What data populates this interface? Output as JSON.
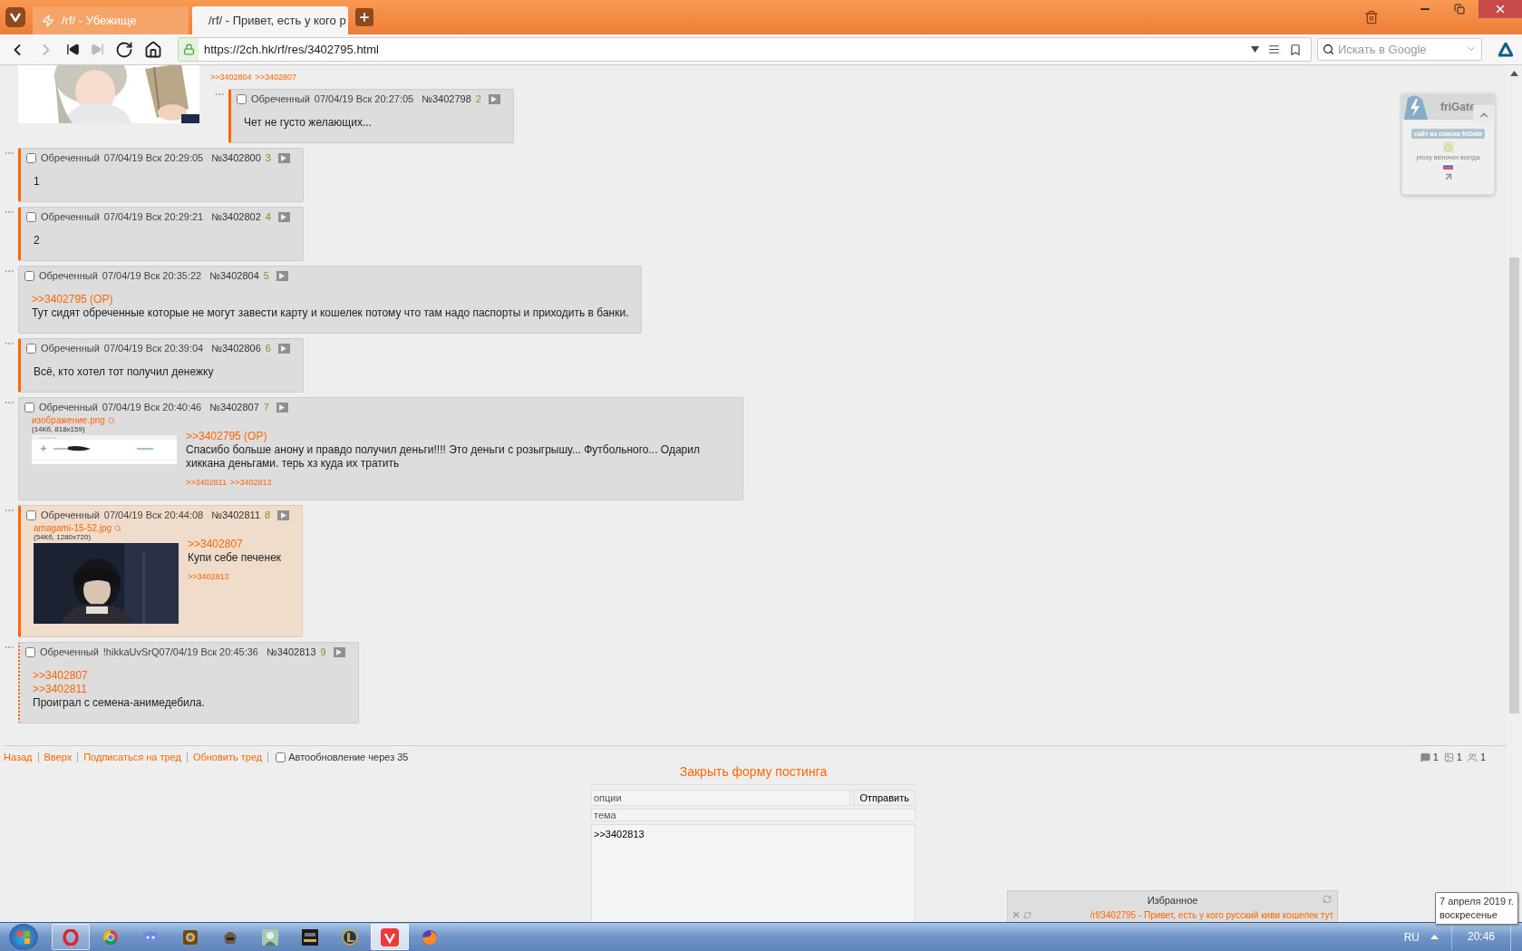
{
  "browser": {
    "tabs": [
      {
        "title": "/rf/ - Убежище",
        "selected": false
      },
      {
        "title": "/rf/ - Привет, есть у кого р",
        "selected": true
      }
    ],
    "nav": [
      {
        "kind": "back",
        "disabled": false
      },
      {
        "kind": "forward",
        "disabled": true
      },
      {
        "kind": "first",
        "disabled": false
      },
      {
        "kind": "last",
        "disabled": true
      },
      {
        "kind": "reload",
        "disabled": false
      },
      {
        "kind": "home",
        "disabled": false
      }
    ],
    "url": "https://2ch.hk/rf/res/3402795.html",
    "search": {
      "placeholder": "Искать в Google"
    }
  },
  "thread": {
    "cut_post": {
      "backlinks": [
        ">>3402804",
        ">>3402807"
      ],
      "replies": [
        {
          "name": "Обреченный",
          "date": "07/04/19 Вск 20:27:05",
          "number": "№3402798",
          "index": "2",
          "checked": false,
          "kind": "solid",
          "highlighted": false,
          "text": "Чет не густо желающих..."
        }
      ]
    },
    "posts": [
      {
        "name": "Обреченный",
        "date": "07/04/19 Вск 20:29:05",
        "number": "№3402800",
        "index": "3",
        "checked": false,
        "kind": "solid",
        "highlighted": false,
        "text": "1"
      },
      {
        "name": "Обреченный",
        "date": "07/04/19 Вск 20:29:21",
        "number": "№3402802",
        "index": "4",
        "checked": false,
        "kind": "solid",
        "highlighted": false,
        "text": "2"
      },
      {
        "name": "Обреченный",
        "date": "07/04/19 Вск 20:35:22",
        "number": "№3402804",
        "index": "5",
        "checked": false,
        "kind": "plain",
        "highlighted": false,
        "quotes": [
          ">>3402795 (OP)"
        ],
        "text": "Тут сидят обреченные которые не могут завести карту и кошелек потому что там надо паспорты и приходить в банки."
      },
      {
        "name": "Обреченный",
        "date": "07/04/19 Вск 20:39:04",
        "number": "№3402806",
        "index": "6",
        "checked": false,
        "kind": "solid",
        "highlighted": false,
        "text": "Всё, кто хотел тот получил денежку"
      },
      {
        "name": "Обреченный",
        "date": "07/04/19 Вск 20:40:46",
        "number": "№3402807",
        "index": "7",
        "checked": false,
        "kind": "plain",
        "highlighted": false,
        "file": {
          "kind": "screenshot",
          "name": "изображение.png",
          "info": "(14Кб, 818x159)"
        },
        "quotes": [
          ">>3402795 (OP)"
        ],
        "text": "Спасибо больше анону и правдо получил деньги!!!! Это деньги с розыгрышу... Футбольного... Одарил хиккана деньгами. терь хз куда их тратить",
        "backlinks": [
          ">>3402811",
          ">>3402813"
        ]
      },
      {
        "name": "Обреченный",
        "date": "07/04/19 Вск 20:44:08",
        "number": "№3402811",
        "index": "8",
        "checked": false,
        "kind": "solid",
        "highlighted": true,
        "file": {
          "kind": "scene",
          "name": "amagami-15-52.jpg",
          "info": "(54Кб, 1280x720)"
        },
        "quotes": [
          ">>3402807"
        ],
        "text": "Купи себе печенек",
        "backlinks": [
          ">>3402813"
        ]
      },
      {
        "name": "Обреченный",
        "trip": "!hikkaUvSrQ",
        "date": "07/04/19 Вск 20:45:36",
        "number": "№3402813",
        "index": "9",
        "checked": false,
        "kind": "dotted",
        "highlighted": false,
        "quotes": [
          ">>3402807",
          ">>3402811"
        ],
        "text": "Проиграл с семена-анимедебила."
      }
    ]
  },
  "footer": {
    "links": [
      "Назад",
      "Вверх",
      "Подписаться на тред",
      "Обновить тред"
    ],
    "autoupdate": {
      "label": "Автообновление через 35",
      "checked": false
    },
    "stats": [
      {
        "kind": "posts",
        "value": "1"
      },
      {
        "kind": "images",
        "value": "1"
      },
      {
        "kind": "users",
        "value": "1"
      }
    ]
  },
  "form": {
    "toggle": "Закрыть форму постинга",
    "options": {
      "placeholder": "опции"
    },
    "submit": "Отправить",
    "subject": {
      "placeholder": "тема"
    },
    "message": {
      "value": ">>3402813"
    }
  },
  "frigate": {
    "title": "friGate",
    "badge": "сайт из списка friGate",
    "status": "proxy включен всегда"
  },
  "favorites": {
    "title": "Избранное",
    "entries": [
      "/rf/3402795 - Привет, есть у кого русский киви кошелек тут"
    ]
  },
  "taskbar": {
    "apps": [
      {
        "kind": "ring",
        "open": true,
        "selected": false
      },
      {
        "kind": "wheel",
        "open": false,
        "selected": false
      },
      {
        "kind": "gamepad",
        "open": false,
        "selected": false
      },
      {
        "kind": "emblem",
        "open": false,
        "selected": false
      },
      {
        "kind": "helmet",
        "open": false,
        "selected": false
      },
      {
        "kind": "figure",
        "open": false,
        "selected": false
      },
      {
        "kind": "tile",
        "open": false,
        "selected": false
      },
      {
        "kind": "shield",
        "open": false,
        "selected": false
      },
      {
        "kind": "vee",
        "open": true,
        "selected": true
      },
      {
        "kind": "globe",
        "open": false,
        "selected": false
      }
    ],
    "language": "RU",
    "time": "20:46",
    "tooltip": {
      "date": "7 апреля 2019 г.",
      "weekday": "воскресенье"
    }
  }
}
